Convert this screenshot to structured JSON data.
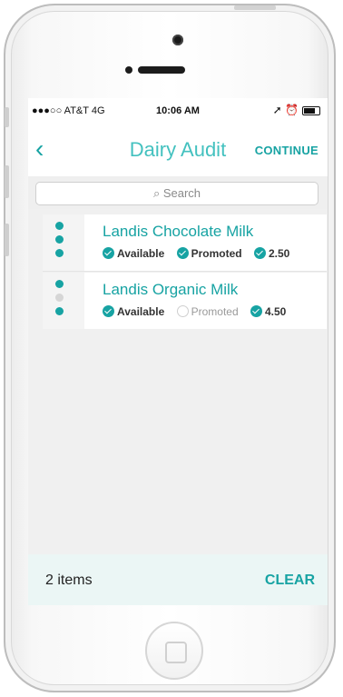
{
  "status_bar": {
    "carrier": "●●●○○ AT&T  4G",
    "time": "10:06 AM",
    "right_icons": "➚ ⏰"
  },
  "navbar": {
    "back_label": "‹",
    "title": "Dairy Audit",
    "continue_label": "CONTINUE"
  },
  "search": {
    "placeholder": "⌕ Search"
  },
  "items": [
    {
      "name": "Landis Chocolate Milk",
      "indicators": [
        true,
        true,
        true
      ],
      "chips": [
        {
          "label": "Available",
          "checked": true
        },
        {
          "label": "Promoted",
          "checked": true
        },
        {
          "label": "2.50",
          "checked": true
        }
      ]
    },
    {
      "name": "Landis Organic Milk",
      "indicators": [
        true,
        false,
        true
      ],
      "chips": [
        {
          "label": "Available",
          "checked": true
        },
        {
          "label": "Promoted",
          "checked": false
        },
        {
          "label": "4.50",
          "checked": true
        }
      ]
    }
  ],
  "footer": {
    "count": "2 items",
    "clear_label": "CLEAR"
  },
  "colors": {
    "accent": "#17a3a3",
    "title": "#43c1bf",
    "footer_bg": "#ebf6f5"
  }
}
